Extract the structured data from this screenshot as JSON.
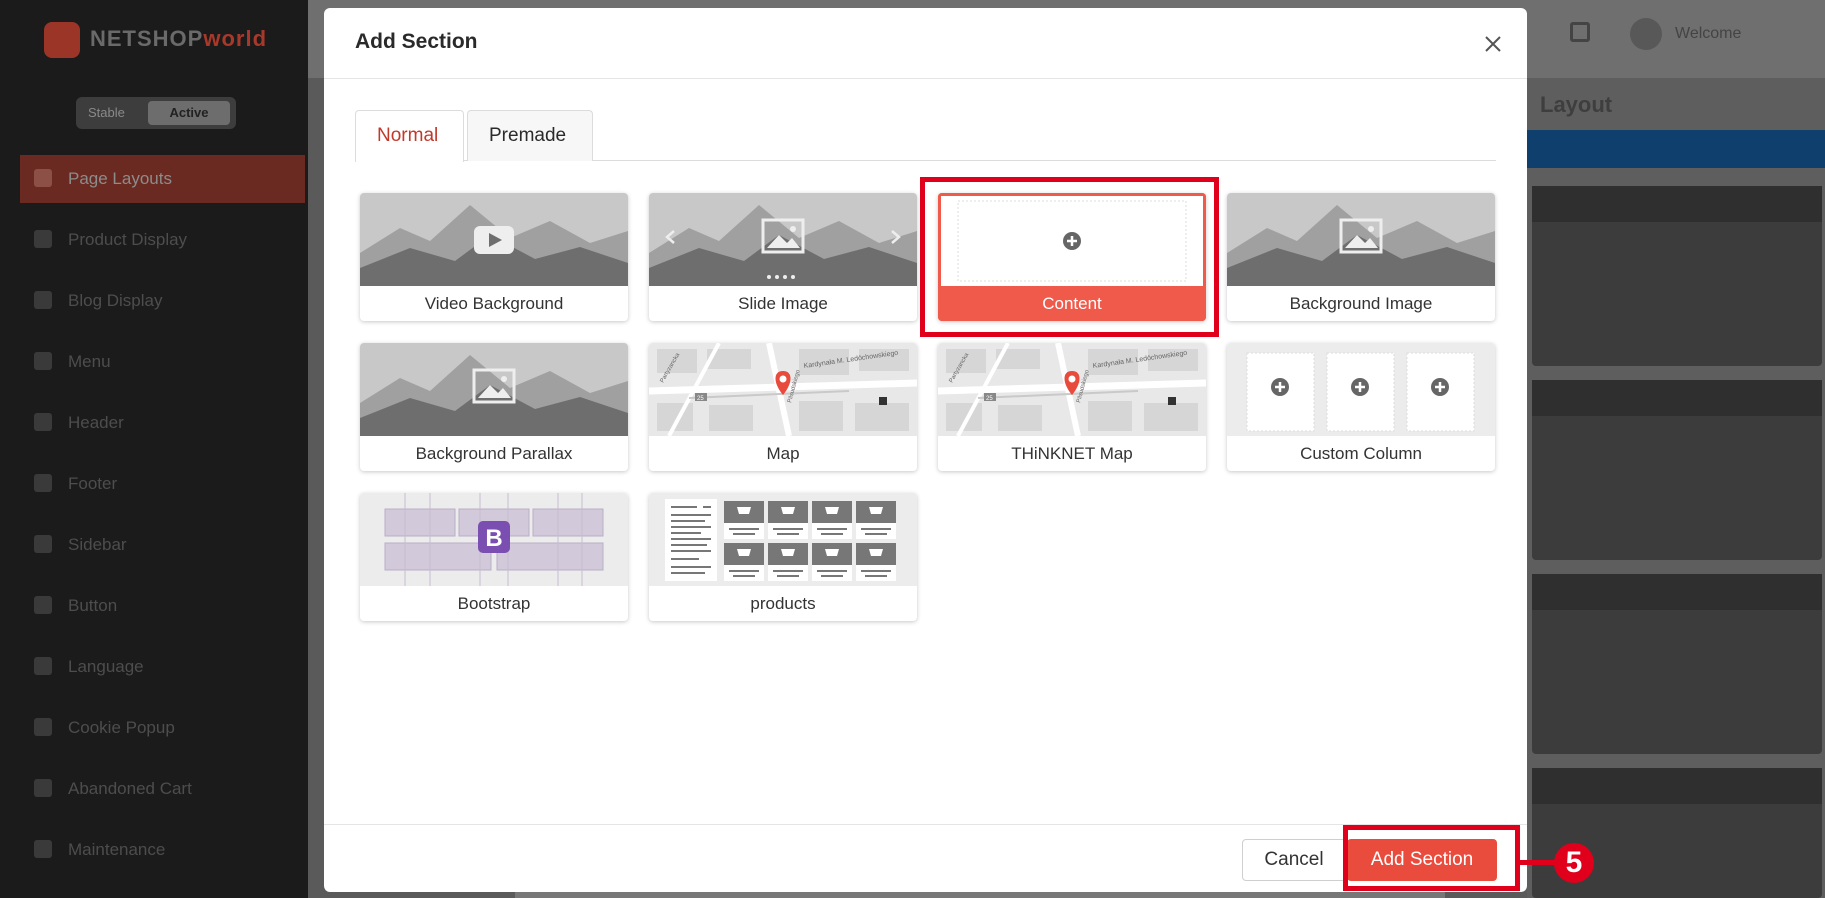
{
  "background": {
    "logo_text": "NETSHOP",
    "logo_accent": "world",
    "switcher": {
      "left": "Stable",
      "right": "Active"
    },
    "sidebar_items": [
      {
        "label": "Page Layouts",
        "icon": "layout-icon",
        "active": true
      },
      {
        "label": "Product Display",
        "icon": "box-icon"
      },
      {
        "label": "Blog Display",
        "icon": "blog-icon"
      },
      {
        "label": "Menu",
        "icon": "menu-icon"
      },
      {
        "label": "Header",
        "icon": "header-icon"
      },
      {
        "label": "Footer",
        "icon": "footer-icon"
      },
      {
        "label": "Sidebar",
        "icon": "sidebar-icon"
      },
      {
        "label": "Button",
        "icon": "button-icon"
      },
      {
        "label": "Language",
        "icon": "language-icon"
      },
      {
        "label": "Cookie Popup",
        "icon": "cookie-icon"
      },
      {
        "label": "Abandoned Cart",
        "icon": "cart-icon"
      },
      {
        "label": "Maintenance",
        "icon": "maintenance-icon"
      }
    ],
    "right_panel_title": "Layout",
    "right_panel_button": "Add Section",
    "user_name": "Welcome"
  },
  "modal": {
    "title": "Add Section",
    "tabs": [
      {
        "label": "Normal",
        "active": true
      },
      {
        "label": "Premade",
        "active": false
      }
    ],
    "sections": [
      {
        "label": "Video Background",
        "thumb": "video"
      },
      {
        "label": "Slide Image",
        "thumb": "slide"
      },
      {
        "label": "Content",
        "thumb": "content",
        "selected": true
      },
      {
        "label": "Background Image",
        "thumb": "image"
      },
      {
        "label": "Background Parallax",
        "thumb": "image"
      },
      {
        "label": "Map",
        "thumb": "map"
      },
      {
        "label": "THiNKNET Map",
        "thumb": "map"
      },
      {
        "label": "Custom Column",
        "thumb": "columns"
      },
      {
        "label": "Bootstrap",
        "thumb": "bootstrap"
      },
      {
        "label": "products",
        "thumb": "products"
      }
    ],
    "map_labels": {
      "street1": "Kardynała M. Ledóchowskiego",
      "street2": "Partyzancka",
      "street3": "Pilsudskiego",
      "num": "25"
    },
    "bootstrap_letter": "B",
    "cancel_label": "Cancel",
    "add_label": "Add Section"
  },
  "annotation": {
    "step": "5"
  },
  "colors": {
    "accent": "#e94b3c",
    "tab_active_text": "#c0392b",
    "highlight": "#e0001b",
    "bootstrap": "#7a4fb1"
  }
}
